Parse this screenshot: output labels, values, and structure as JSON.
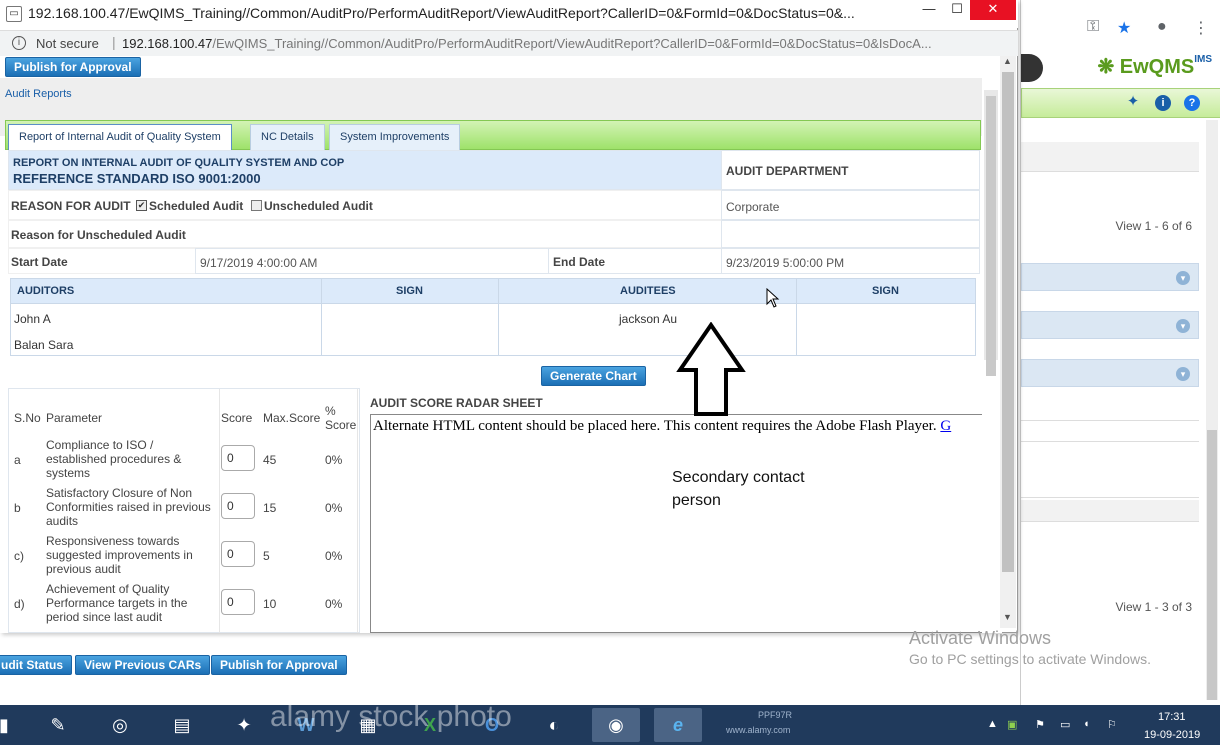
{
  "popup": {
    "title": "192.168.100.47/EwQIMS_Training//Common/AuditPro/PerformAuditReport/ViewAuditReport?CallerID=0&FormId=0&DocStatus=0&...",
    "security_label": "Not secure",
    "url_host": "192.168.100.47",
    "url_path": "/EwQIMS_Training//Common/AuditPro/PerformAuditReport/ViewAuditReport?CallerID=0&FormId=0&DocStatus=0&IsDocA...",
    "window_min": "—",
    "window_max": "☐",
    "window_close": "✕"
  },
  "toolbar": {
    "publish_label": "Publish for Approval"
  },
  "breadcrumb": "Audit Reports",
  "tabs": [
    {
      "label": "Report of Internal Audit of Quality System",
      "active": true
    },
    {
      "label": "NC Details",
      "active": false
    },
    {
      "label": "System Improvements",
      "active": false
    }
  ],
  "report": {
    "title_line1": "REPORT ON INTERNAL AUDIT OF QUALITY SYSTEM AND COP",
    "title_line2": "REFERENCE STANDARD ISO 9001:2000",
    "dept_label": "AUDIT DEPARTMENT",
    "dept_value": "Corporate",
    "reason_label": "REASON FOR AUDIT",
    "scheduled_label": "Scheduled Audit",
    "scheduled_checked": true,
    "unscheduled_label": "Unscheduled Audit",
    "unscheduled_checked": false,
    "unscheduled_reason_label": "Reason for Unscheduled Audit",
    "start_label": "Start Date",
    "start_value": "9/17/2019 4:00:00 AM",
    "end_label": "End Date",
    "end_value": "9/23/2019 5:00:00 PM"
  },
  "auditors_table": {
    "headers": [
      "AUDITORS",
      "SIGN",
      "AUDITEES",
      "SIGN"
    ],
    "auditors": [
      "John A",
      "Balan Sara"
    ],
    "auditees": [
      "jackson Au"
    ]
  },
  "generate_chart_label": "Generate Chart",
  "score_table": {
    "headers": {
      "sno": "S.No",
      "parameter": "Parameter",
      "score": "Score",
      "max": "Max.Score",
      "pct": "% Score"
    },
    "rows": [
      {
        "sno": "a",
        "parameter": "Compliance to ISO / established procedures & systems",
        "score": "0",
        "max": "45",
        "pct": "0%"
      },
      {
        "sno": "b",
        "parameter": "Satisfactory Closure of Non Conformities raised in previous audits",
        "score": "0",
        "max": "15",
        "pct": "0%"
      },
      {
        "sno": "c)",
        "parameter": "Responsiveness towards suggested improvements in previous audit",
        "score": "0",
        "max": "5",
        "pct": "0%"
      },
      {
        "sno": "d)",
        "parameter": "Achievement of Quality Performance targets in the period since last audit",
        "score": "0",
        "max": "10",
        "pct": "0%"
      }
    ]
  },
  "radar": {
    "title": "AUDIT SCORE RADAR SHEET",
    "alt_text": "Alternate HTML content should be placed here. This content requires the Adobe Flash Player.",
    "alt_link": "G"
  },
  "annotation": {
    "line1": "Secondary contact",
    "line2": "person"
  },
  "bottom_toolbar": {
    "audit_status": "udit Status",
    "view_cars": "View Previous CARs",
    "publish": "Publish for Approval"
  },
  "background_app": {
    "logo": "EwQMS",
    "logo_sup": "IMS",
    "view1": "View 1 - 6 of 6",
    "view2": "View 1 - 3 of 3"
  },
  "windows_watermark": {
    "title": "Activate Windows",
    "subtitle": "Go to PC settings to activate Windows."
  },
  "stock_watermark": "alamy stock photo",
  "taskbar": {
    "apps": [
      {
        "icon": "folder-icon",
        "glyph": "▮"
      },
      {
        "icon": "notepad-plus-icon",
        "glyph": "✎"
      },
      {
        "icon": "safari-icon",
        "glyph": "◎"
      },
      {
        "icon": "file-explorer-icon",
        "glyph": "▤"
      },
      {
        "icon": "paint-icon",
        "glyph": "✦"
      },
      {
        "icon": "word-icon",
        "glyph": "W"
      },
      {
        "icon": "calculator-icon",
        "glyph": "▦"
      },
      {
        "icon": "excel-icon",
        "glyph": "X"
      },
      {
        "icon": "outlook-icon",
        "glyph": "O"
      },
      {
        "icon": "eclipse-icon",
        "glyph": "◐"
      },
      {
        "icon": "chrome-icon",
        "glyph": "◉"
      },
      {
        "icon": "ie-icon",
        "glyph": "e"
      }
    ],
    "stock_code": "PPF97R",
    "stock_url": "www.alamy.com",
    "time": "17:31",
    "date": "19-09-2019"
  }
}
